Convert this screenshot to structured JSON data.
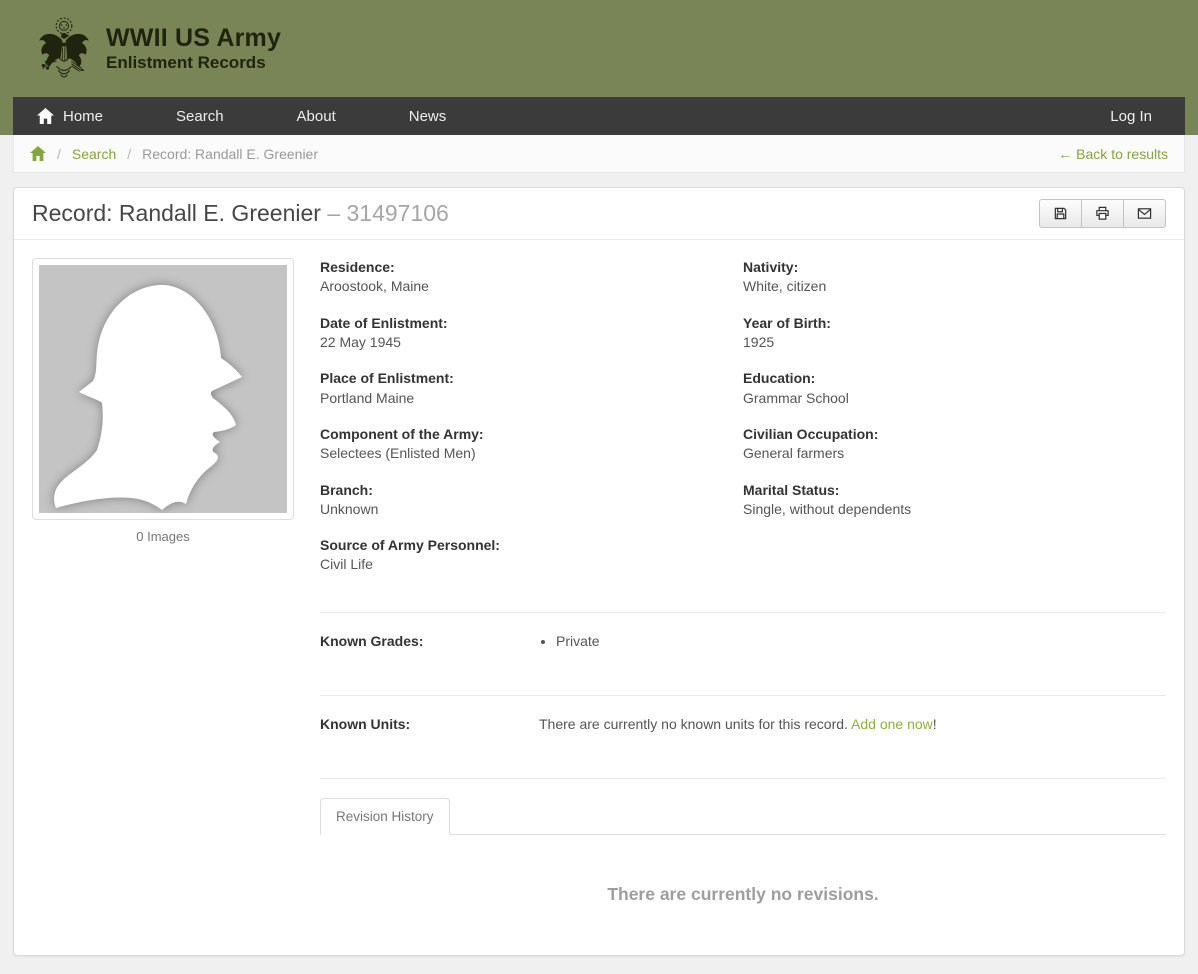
{
  "colors": {
    "olive_header": "#7a8557",
    "nav_dark": "#3b3b3b",
    "link_green": "#84a53f",
    "add_link_green": "#8cb23c",
    "page_bg": "#f0f0f0"
  },
  "site": {
    "title_line1": "WWII US Army",
    "title_line2": "Enlistment Records",
    "logo_icon": "us-great-seal-eagle"
  },
  "nav": {
    "items": [
      {
        "label": "Home",
        "icon": "home-icon"
      },
      {
        "label": "Search"
      },
      {
        "label": "About"
      },
      {
        "label": "News"
      }
    ],
    "login_label": "Log In"
  },
  "breadcrumb": {
    "home_icon": "home-icon",
    "separator": "/",
    "search_link": "Search",
    "current": "Record: Randall E. Greenier",
    "back_link": "← Back to results"
  },
  "record": {
    "title": "Record: Randall E. Greenier",
    "number_prefix": "– ",
    "serial_number": "31497106",
    "toolbar_icons": [
      "save-icon",
      "print-icon",
      "email-icon"
    ],
    "images_caption": "0 Images",
    "portrait_icon": "soldier-silhouette",
    "fields_left": [
      {
        "label": "Residence:",
        "value": "Aroostook, Maine"
      },
      {
        "label": "Date of Enlistment:",
        "value": "22 May 1945"
      },
      {
        "label": "Place of Enlistment:",
        "value": "Portland Maine"
      },
      {
        "label": "Component of the Army:",
        "value": "Selectees (Enlisted Men)"
      },
      {
        "label": "Branch:",
        "value": "Unknown"
      },
      {
        "label": "Source of Army Personnel:",
        "value": "Civil Life"
      }
    ],
    "fields_right": [
      {
        "label": "Nativity:",
        "value": "White, citizen"
      },
      {
        "label": "Year of Birth:",
        "value": "1925"
      },
      {
        "label": "Education:",
        "value": "Grammar School"
      },
      {
        "label": "Civilian Occupation:",
        "value": "General farmers"
      },
      {
        "label": "Marital Status:",
        "value": "Single, without dependents"
      }
    ],
    "known_grades": {
      "label": "Known Grades:",
      "items": [
        "Private"
      ]
    },
    "known_units": {
      "label": "Known Units:",
      "empty_text": "There are currently no known units for this record. ",
      "add_link": "Add one now",
      "suffix": "!"
    },
    "revision": {
      "tab_label": "Revision History",
      "empty_text": "There are currently no revisions."
    }
  }
}
